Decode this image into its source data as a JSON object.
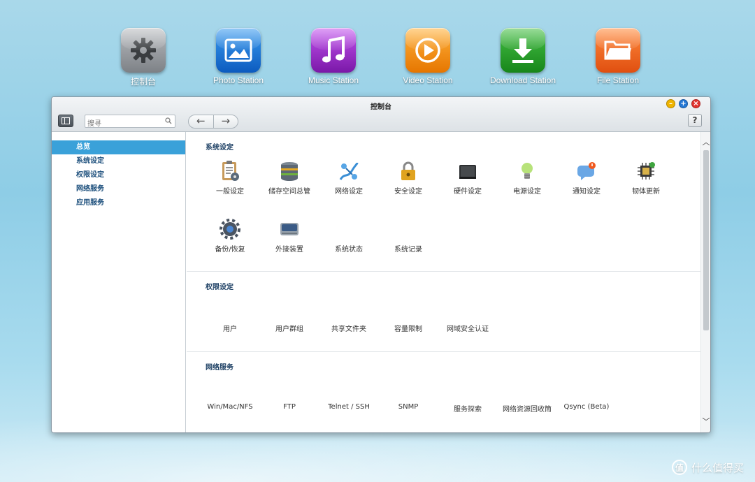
{
  "dock": {
    "apps": [
      {
        "label": "控制台",
        "icon": "gear-icon",
        "color": "#8e9297"
      },
      {
        "label": "Photo Station",
        "icon": "photo-icon",
        "color": "#1f78d6"
      },
      {
        "label": "Music Station",
        "icon": "music-note-icon",
        "color": "#9b2fc9"
      },
      {
        "label": "Video Station",
        "icon": "play-icon",
        "color": "#f18a00"
      },
      {
        "label": "Download Station",
        "icon": "download-icon",
        "color": "#2aa52a"
      },
      {
        "label": "File Station",
        "icon": "folder-icon",
        "color": "#f0631c"
      }
    ]
  },
  "window": {
    "title": "控制台",
    "search_placeholder": "搜寻",
    "help_label": "?"
  },
  "sidebar": {
    "items": [
      {
        "label": "总览",
        "active": true
      },
      {
        "label": "系统设定"
      },
      {
        "label": "权限设定"
      },
      {
        "label": "网络服务"
      },
      {
        "label": "应用服务"
      }
    ]
  },
  "sections": {
    "system": {
      "title": "系统设定",
      "items": [
        "一般设定",
        "储存空间总管",
        "网络设定",
        "安全设定",
        "硬件设定",
        "电源设定",
        "通知设定",
        "韧体更新",
        "备份/恢复",
        "外接装置",
        "系统状态",
        "系统记录"
      ]
    },
    "privilege": {
      "title": "权限设定",
      "items": [
        "用户",
        "用户群组",
        "共享文件夹",
        "容量限制",
        "网域安全认证"
      ]
    },
    "network": {
      "title": "网络服务",
      "items": [
        "Win/Mac/NFS",
        "FTP",
        "Telnet / SSH",
        "SNMP",
        "服务探索",
        "网络资源回收筒",
        "Qsync (Beta)"
      ]
    }
  },
  "watermark": {
    "logo": "值",
    "text": "什么值得买"
  }
}
